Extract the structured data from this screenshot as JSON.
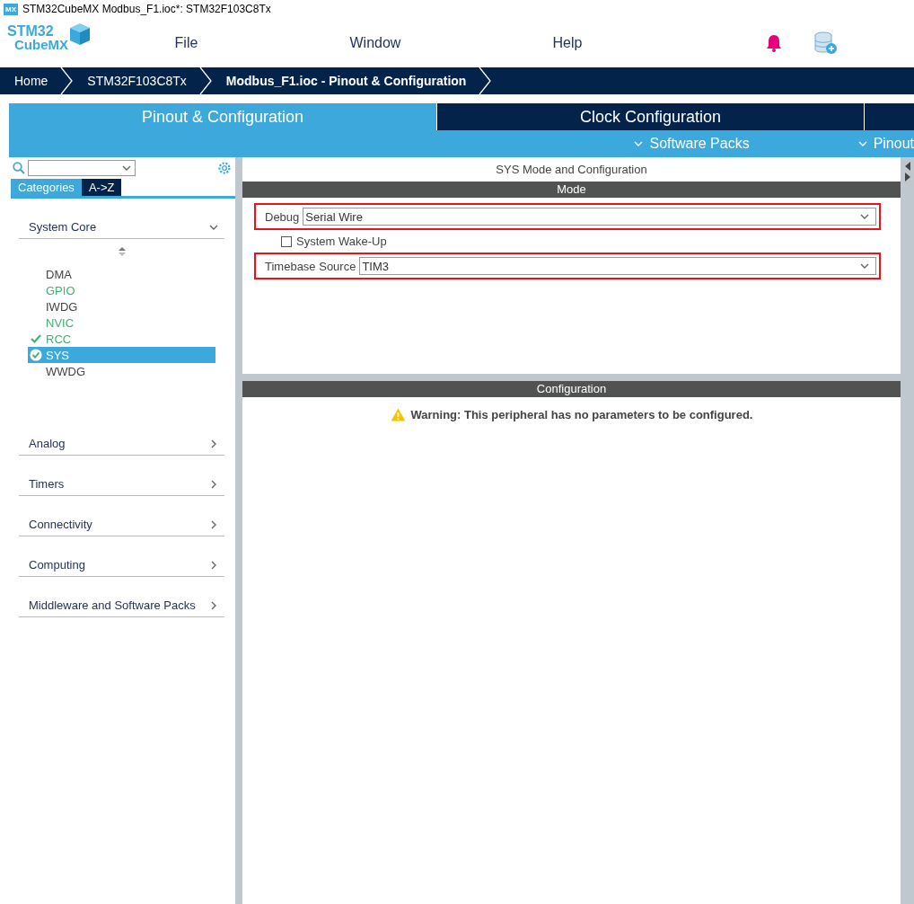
{
  "window": {
    "title": "STM32CubeMX Modbus_F1.ioc*: STM32F103C8Tx",
    "app_badge": "MX"
  },
  "logo": {
    "line1": "STM32",
    "line2": "CubeMX"
  },
  "menu": [
    "File",
    "Window",
    "Help"
  ],
  "breadcrumb": [
    {
      "label": "Home",
      "selected": false
    },
    {
      "label": "STM32F103C8Tx",
      "selected": false
    },
    {
      "label": "Modbus_F1.ioc - Pinout & Configuration",
      "selected": true
    }
  ],
  "tabs": [
    {
      "label": "Pinout & Configuration",
      "selected": true
    },
    {
      "label": "Clock Configuration",
      "selected": false
    }
  ],
  "subbar": [
    "Software Packs",
    "Pinout"
  ],
  "sidebar": {
    "view_tabs": [
      {
        "label": "Categories",
        "selected": true
      },
      {
        "label": "A->Z",
        "selected": false
      }
    ],
    "categories": [
      {
        "label": "System Core",
        "expanded": true,
        "items": [
          {
            "label": "DMA",
            "configured": false,
            "checked": false,
            "selected": false
          },
          {
            "label": "GPIO",
            "configured": true,
            "checked": false,
            "selected": false
          },
          {
            "label": "IWDG",
            "configured": false,
            "checked": false,
            "selected": false
          },
          {
            "label": "NVIC",
            "configured": true,
            "checked": false,
            "selected": false
          },
          {
            "label": "RCC",
            "configured": true,
            "checked": true,
            "selected": false
          },
          {
            "label": "SYS",
            "configured": true,
            "checked": true,
            "selected": true
          },
          {
            "label": "WWDG",
            "configured": false,
            "checked": false,
            "selected": false
          }
        ]
      },
      {
        "label": "Analog",
        "expanded": false
      },
      {
        "label": "Timers",
        "expanded": false
      },
      {
        "label": "Connectivity",
        "expanded": false
      },
      {
        "label": "Computing",
        "expanded": false
      },
      {
        "label": "Middleware and Software Packs",
        "expanded": false
      }
    ]
  },
  "panel": {
    "title": "SYS Mode and Configuration",
    "mode_header": "Mode",
    "mode_fields": [
      {
        "kind": "dropdown",
        "label": "Debug",
        "value": "Serial Wire",
        "highlighted": true
      },
      {
        "kind": "checkbox",
        "label": "System Wake-Up",
        "checked": false
      },
      {
        "kind": "dropdown",
        "label": "Timebase Source",
        "value": "TIM3",
        "highlighted": true
      }
    ],
    "config_header": "Configuration",
    "warning": "Warning: This peripheral has no parameters to be configured."
  }
}
